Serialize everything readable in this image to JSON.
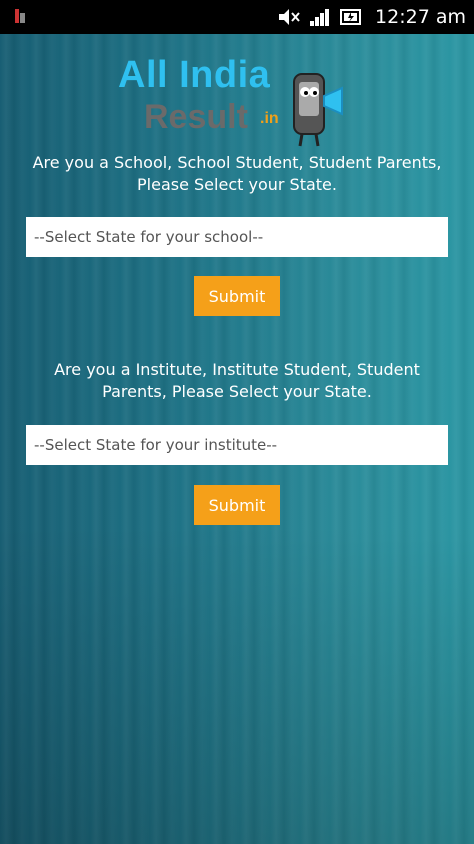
{
  "status_bar": {
    "time": "12:27 am",
    "icons": [
      "notification-icon",
      "mute-icon",
      "signal-icon",
      "battery-icon"
    ]
  },
  "logo": {
    "line1": "All India",
    "line2": "Result",
    "suffix": ".in"
  },
  "school": {
    "prompt_line1": "Are you a School, School Student, Student Parents,",
    "prompt_line2": "Please Select your State.",
    "select_placeholder": "--Select State for your school--",
    "submit_label": "Submit"
  },
  "institute": {
    "prompt_line1": "Are you a Institute, Institute Student, Student",
    "prompt_line2": "Parents, Please Select your State.",
    "select_placeholder": "--Select State for your institute--",
    "submit_label": "Submit"
  },
  "colors": {
    "accent": "#f5a019",
    "logo_blue": "#2fc0f0",
    "background": "#1e6e82"
  }
}
